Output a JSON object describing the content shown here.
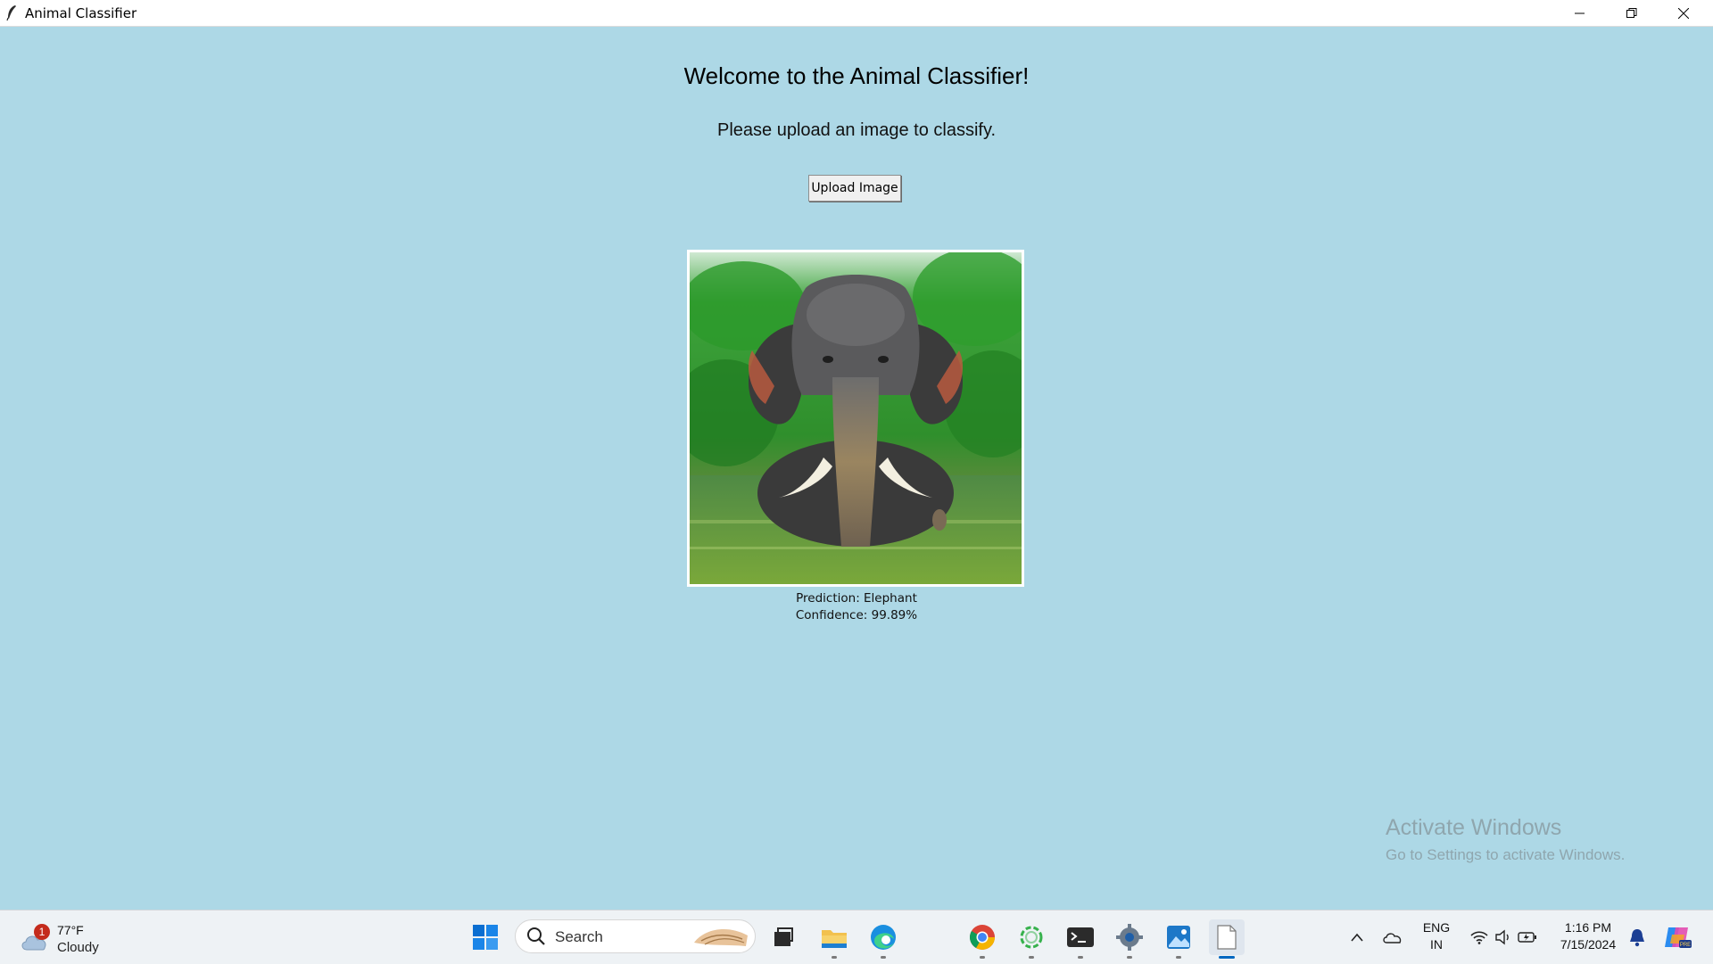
{
  "window": {
    "title": "Animal Classifier"
  },
  "app": {
    "heading": "Welcome to the Animal Classifier!",
    "instruction": "Please upload an image to classify.",
    "upload_button": "Upload Image",
    "prediction_line": "Prediction: Elephant",
    "confidence_line": "Confidence: 99.89%",
    "image_subject": "elephant-photo"
  },
  "watermark": {
    "line1": "Activate Windows",
    "line2": "Go to Settings to activate Windows."
  },
  "taskbar": {
    "weather": {
      "temp": "77°F",
      "condition": "Cloudy",
      "badge": "1"
    },
    "search_placeholder": "Search",
    "pinned_apps": [
      "start-icon",
      "task-view-icon",
      "file-explorer-icon",
      "edge-icon",
      "chrome-icon",
      "loading-app-icon",
      "terminal-icon",
      "settings-icon",
      "photos-icon",
      "notepad-icon"
    ],
    "tray": {
      "language_line1": "ENG",
      "language_line2": "IN",
      "time": "1:16 PM",
      "date": "7/15/2024"
    }
  },
  "colors": {
    "app_background": "#add8e6",
    "taskbar_background": "#eef2f5",
    "accent": "#0067c0"
  }
}
